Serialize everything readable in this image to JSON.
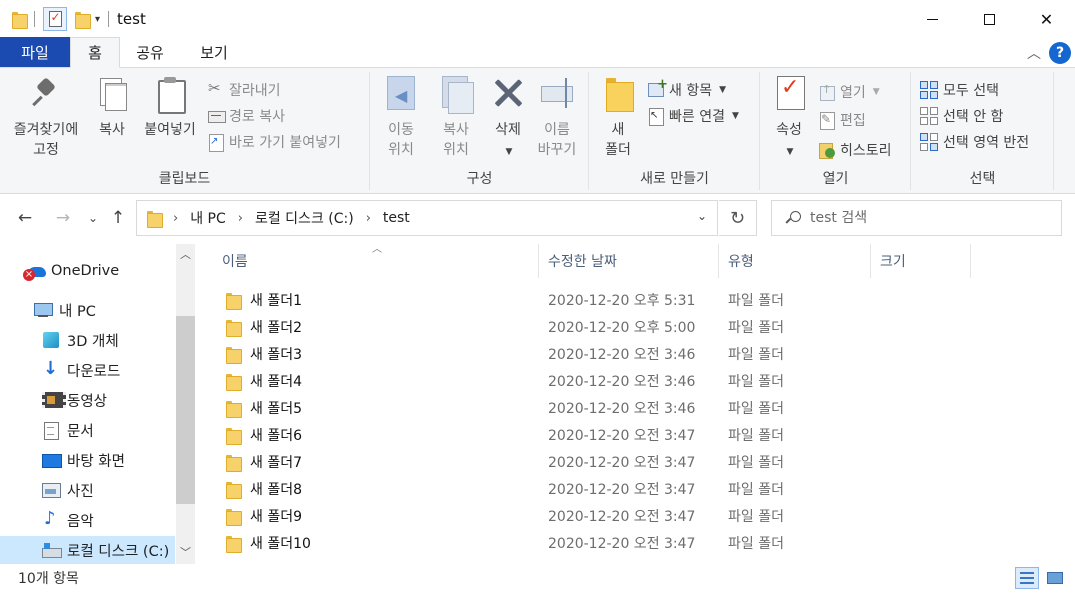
{
  "window": {
    "title": "test"
  },
  "ribbon_tabs": {
    "file": "파일",
    "home": "홈",
    "share": "공유",
    "view": "보기",
    "help": "?"
  },
  "clipboard": {
    "pin": "즐겨찾기에\n고정",
    "copy": "복사",
    "paste": "붙여넣기",
    "cut": "잘라내기",
    "copy_path": "경로 복사",
    "paste_shortcut": "바로 가기 붙여넣기",
    "label": "클립보드"
  },
  "organize": {
    "move_to": "이동\n위치",
    "copy_to": "복사\n위치",
    "delete": "삭제",
    "rename": "이름\n바꾸기",
    "label": "구성"
  },
  "new": {
    "new_folder": "새\n폴더",
    "new_item": "새 항목",
    "easy_access": "빠른 연결",
    "label": "새로 만들기"
  },
  "open": {
    "properties": "속성",
    "open": "열기",
    "edit": "편집",
    "history": "히스토리",
    "label": "열기"
  },
  "select": {
    "select_all": "모두 선택",
    "select_none": "선택 안 함",
    "invert": "선택 영역 반전",
    "label": "선택"
  },
  "address": {
    "crumbs": [
      "내 PC",
      "로컬 디스크 (C:)",
      "test"
    ],
    "search_placeholder": "test 검색"
  },
  "nav_pane": {
    "items": [
      {
        "label": "OneDrive",
        "icon": "onedrive-icon"
      },
      {
        "label": "내 PC",
        "icon": "pc-icon"
      },
      {
        "label": "3D 개체",
        "icon": "cube-icon"
      },
      {
        "label": "다운로드",
        "icon": "download-icon"
      },
      {
        "label": "동영상",
        "icon": "video-icon"
      },
      {
        "label": "문서",
        "icon": "documents-icon"
      },
      {
        "label": "바탕 화면",
        "icon": "desktop-icon"
      },
      {
        "label": "사진",
        "icon": "pictures-icon"
      },
      {
        "label": "음악",
        "icon": "music-icon"
      },
      {
        "label": "로컬 디스크 (C:)",
        "icon": "drive-icon"
      }
    ]
  },
  "columns": {
    "name": "이름",
    "date": "수정한 날짜",
    "type": "유형",
    "size": "크기"
  },
  "files": [
    {
      "name": "새 폴더1",
      "date": "2020-12-20 오후 5:31",
      "type": "파일 폴더"
    },
    {
      "name": "새 폴더2",
      "date": "2020-12-20 오후 5:00",
      "type": "파일 폴더"
    },
    {
      "name": "새 폴더3",
      "date": "2020-12-20 오전 3:46",
      "type": "파일 폴더"
    },
    {
      "name": "새 폴더4",
      "date": "2020-12-20 오전 3:46",
      "type": "파일 폴더"
    },
    {
      "name": "새 폴더5",
      "date": "2020-12-20 오전 3:46",
      "type": "파일 폴더"
    },
    {
      "name": "새 폴더6",
      "date": "2020-12-20 오전 3:47",
      "type": "파일 폴더"
    },
    {
      "name": "새 폴더7",
      "date": "2020-12-20 오전 3:47",
      "type": "파일 폴더"
    },
    {
      "name": "새 폴더8",
      "date": "2020-12-20 오전 3:47",
      "type": "파일 폴더"
    },
    {
      "name": "새 폴더9",
      "date": "2020-12-20 오전 3:47",
      "type": "파일 폴더"
    },
    {
      "name": "새 폴더10",
      "date": "2020-12-20 오전 3:47",
      "type": "파일 폴더"
    }
  ],
  "status": {
    "item_count": "10개 항목"
  },
  "colors": {
    "file_tab": "#1b4bb0",
    "selection": "#cce8ff",
    "accent": "#1467d1"
  }
}
